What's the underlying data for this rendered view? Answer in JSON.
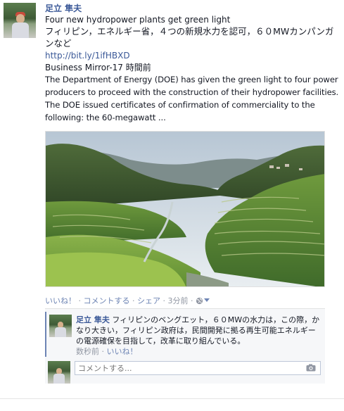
{
  "post": {
    "author": "足立 隼夫",
    "title": "Four new hydropower plants get green light",
    "jp_summary": "フィリピン，エネルギー省，４つの新規水力を認可，６０MWカンパンガンなど",
    "url": "http://bit.ly/1ifHBXD",
    "source": "Business Mirror-17 時間前",
    "description": "The Department of Energy (DOE) has given the green light to four power producers to proceed with the construction of their hydropower facilities. The DOE issued certificates of confirmation of commerciality to the following: the 60-megawatt ..."
  },
  "actions": {
    "like": "いいね！",
    "comment": "コメントする",
    "share": "シェア",
    "time": "3分前"
  },
  "comment": {
    "author": "足立 隼夫",
    "text": "フィリピンのベングエット，６０MWの水力は，この際，かなり大きい，フィリピン政府は，民間開発に拠る再生可能エネルギーの電源確保を目指して，改革に取り組んでいる。",
    "time": "数秒前",
    "like": "いいね！"
  },
  "reply": {
    "placeholder": "コメントする..."
  },
  "icons": {
    "privacy": "globe-icon",
    "dropdown": "chevron-down-icon",
    "camera": "camera-icon"
  },
  "colors": {
    "link": "#3b5998",
    "meta": "#9197a3",
    "accent": "#6d84b4"
  }
}
